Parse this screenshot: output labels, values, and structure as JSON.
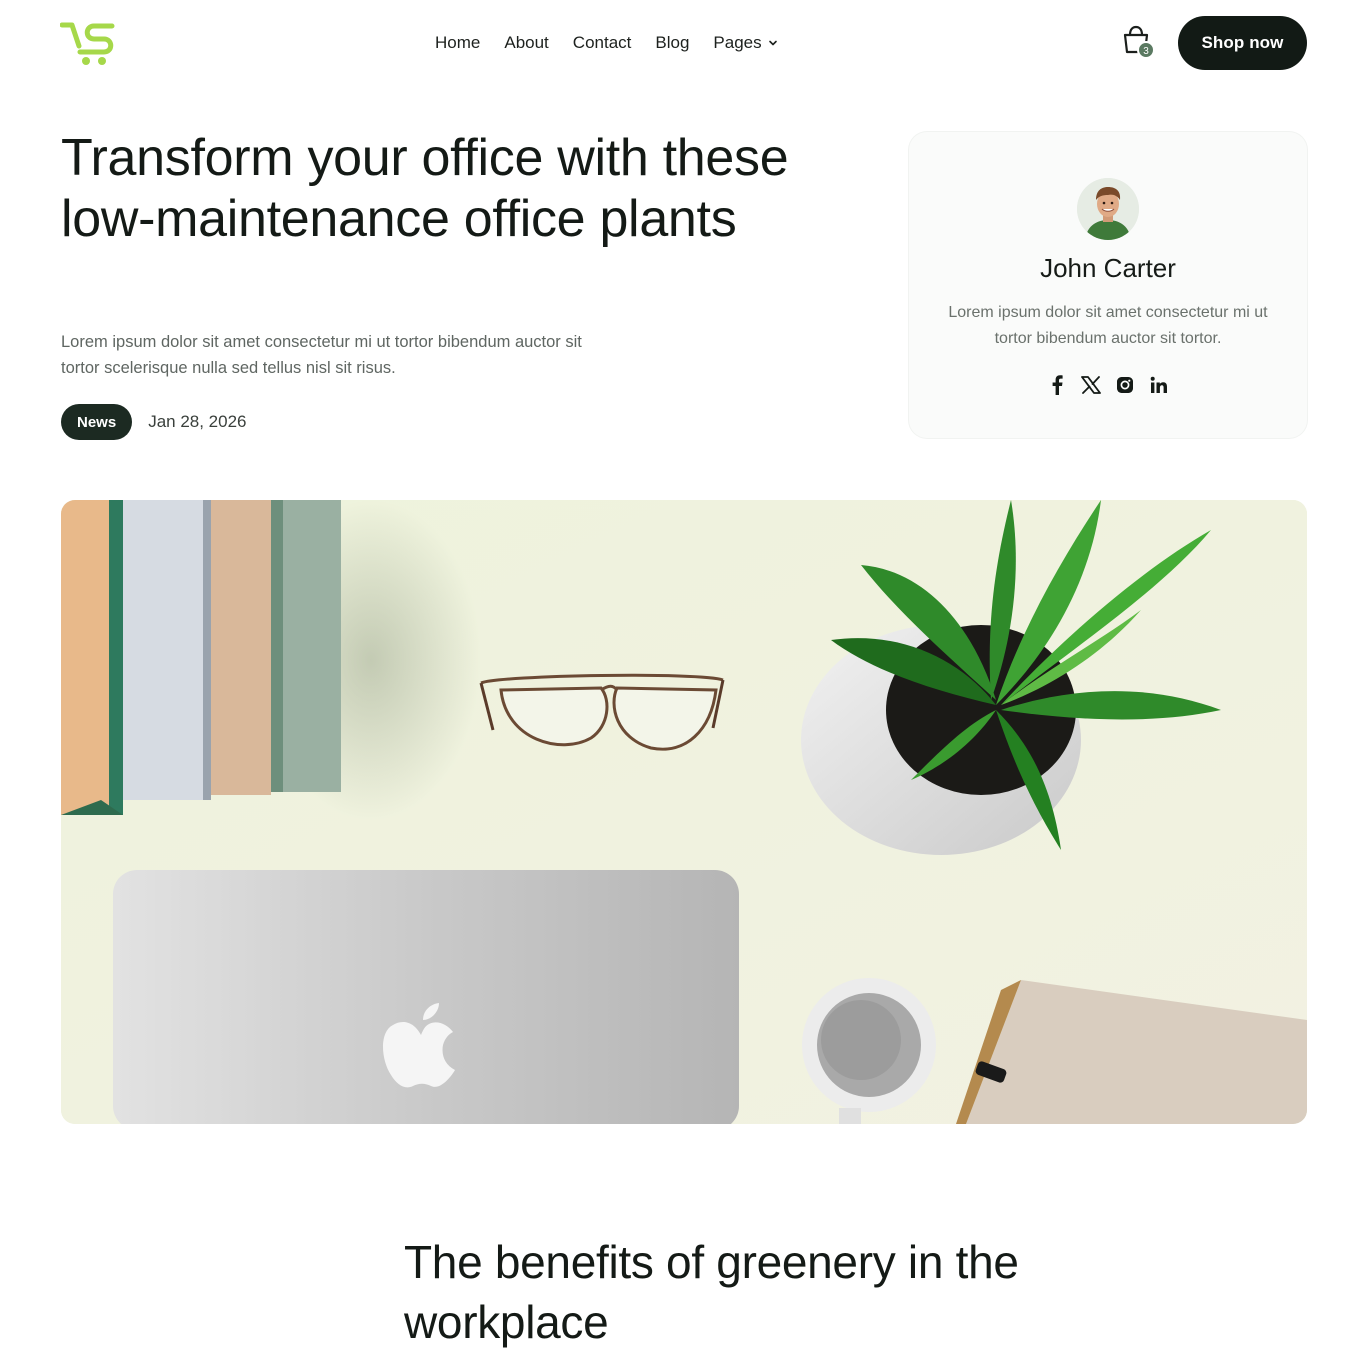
{
  "brand": {
    "logo_color": "#a6d84a"
  },
  "nav": {
    "items": [
      "Home",
      "About",
      "Contact",
      "Blog",
      "Pages"
    ]
  },
  "cart": {
    "count": "3",
    "icon": "shopping-bag-icon"
  },
  "cta": {
    "label": "Shop now",
    "color": "#121a15"
  },
  "hero": {
    "title": "Transform your office with these low-maintenance office plants",
    "description": "Lorem ipsum dolor sit amet consectetur mi ut tortor bibendum auctor sit tortor scelerisque nulla sed tellus nisl sit risus.",
    "tag": "News",
    "date": "Jan 28, 2026"
  },
  "author": {
    "name": "John Carter",
    "bio": "Lorem ipsum dolor sit amet consectetur mi ut tortor bibendum auctor sit tortor.",
    "socials": [
      "facebook-icon",
      "x-icon",
      "instagram-icon",
      "linkedin-icon"
    ]
  },
  "section": {
    "title": "The benefits of greenery in the workplace"
  }
}
